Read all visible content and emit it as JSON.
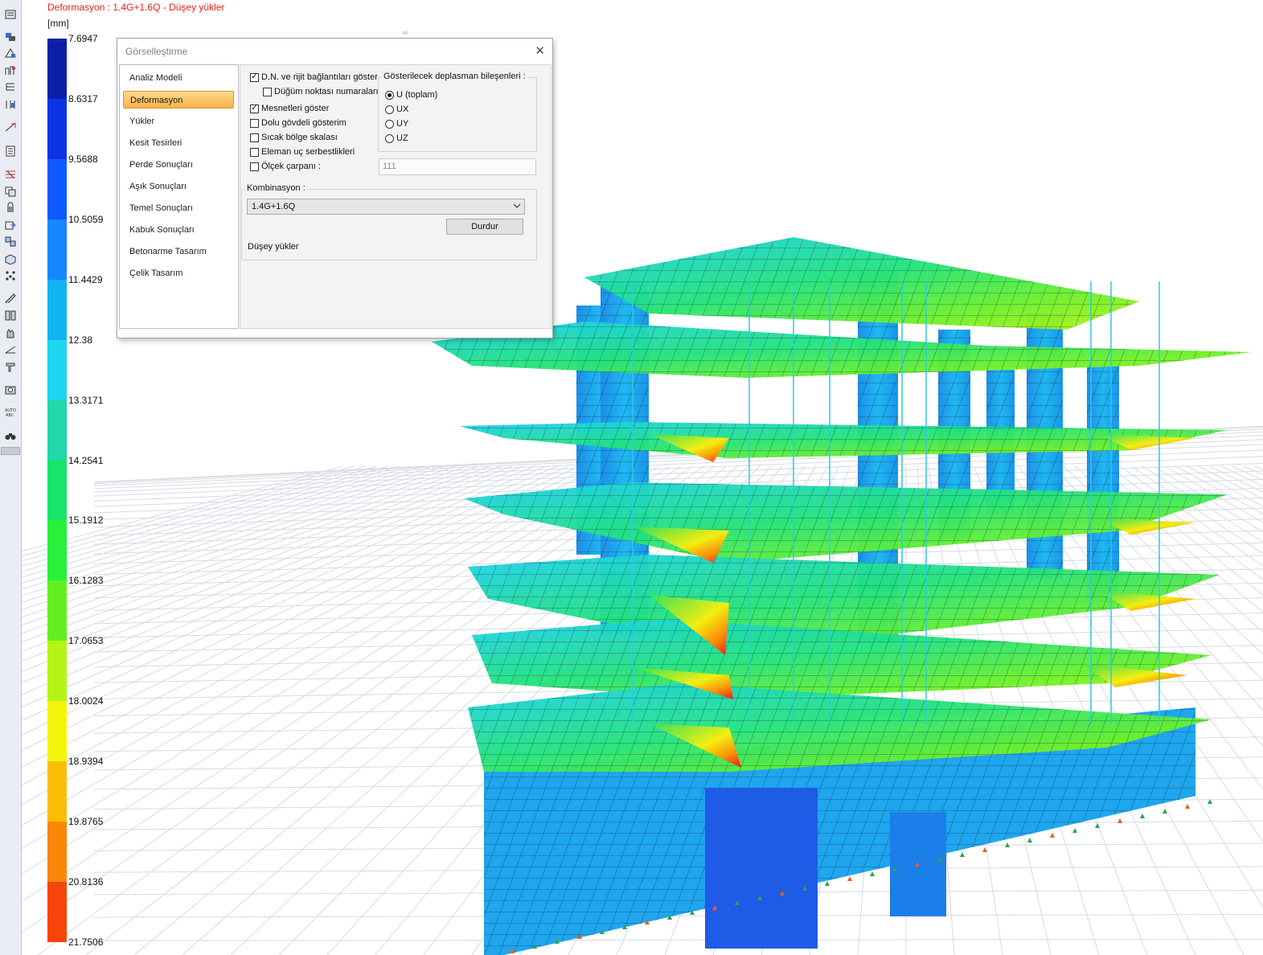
{
  "plot": {
    "title": "Deformasyon : 1.4G+1.6Q  -  Düşey yükler",
    "unit": "[mm]"
  },
  "legend": {
    "values": [
      "7.6947",
      "8.6317",
      "9.5688",
      "10.5059",
      "11.4429",
      "12.38",
      "13.3171",
      "14.2541",
      "15.1912",
      "16.1283",
      "17.0653",
      "18.0024",
      "18.9394",
      "19.8765",
      "20.8136",
      "21.7506"
    ],
    "colors": [
      "#0b1fa8",
      "#0a34e6",
      "#0d5bff",
      "#1686ff",
      "#11b4f3",
      "#1cd6f0",
      "#22d7a9",
      "#17e46a",
      "#28f03b",
      "#62ef22",
      "#b4f516",
      "#f6f40c",
      "#fbbe07",
      "#fb8608",
      "#f7450a",
      "#f10c14",
      "#e2127c"
    ]
  },
  "toolbar": {
    "icons": [
      "list-icon",
      "layer-view-icon",
      "layer-edit-icon",
      "structure-icon",
      "tree-icon",
      "frame-icon",
      "section-icon",
      "report-icon",
      "beam-icon",
      "copy-icon",
      "lock-icon",
      "export-icon",
      "transform-icon",
      "view3d-icon",
      "nodes-icon",
      "draw-icon",
      "measure-icon",
      "hand-icon",
      "slope-icon",
      "column-icon",
      "camera-icon",
      "auto-text-icon",
      "binoculars-icon"
    ],
    "auto_label": "AUTO ABC"
  },
  "dialog": {
    "title": "Görselleştirme",
    "nav": [
      {
        "label": "Analiz Modeli",
        "active": false
      },
      {
        "label": "Deformasyon",
        "active": true
      },
      {
        "label": "Yükler",
        "active": false
      },
      {
        "label": "Kesit Tesirleri",
        "active": false
      },
      {
        "label": "Perde Sonuçları",
        "active": false
      },
      {
        "label": "Aşık Sonuçları",
        "active": false
      },
      {
        "label": "Temel Sonuçları",
        "active": false
      },
      {
        "label": "Kabuk Sonuçları",
        "active": false
      },
      {
        "label": "Betonarme Tasarım",
        "active": false
      },
      {
        "label": "Çelik Tasarım",
        "active": false
      }
    ],
    "options": {
      "show_links": {
        "label": "D.N. ve rijit bağlantıları göster",
        "checked": true
      },
      "node_numbers": {
        "label": "Düğüm noktası numaraları",
        "checked": false
      },
      "show_supports": {
        "label": "Mesnetleri göster",
        "checked": true
      },
      "solid_view": {
        "label": "Dolu gövdeli gösterim",
        "checked": false
      },
      "heat_scale": {
        "label": "Sıcak bölge skalası",
        "checked": false
      },
      "end_releases": {
        "label": "Eleman uç serbestlikleri",
        "checked": false
      },
      "scale_factor": {
        "label": "Ölçek çarpanı :",
        "checked": false
      }
    },
    "scale_value": "111",
    "components": {
      "title": "Gösterilecek deplasman bileşenleri :",
      "options": [
        {
          "label": "U (toplam)",
          "selected": true
        },
        {
          "label": "UX",
          "selected": false
        },
        {
          "label": "UY",
          "selected": false
        },
        {
          "label": "UZ",
          "selected": false
        }
      ]
    },
    "combination": {
      "title": "Kombinasyon :",
      "value": "1.4G+1.6Q",
      "stop_label": "Durdur",
      "load_desc": "Düşey yükler"
    }
  }
}
